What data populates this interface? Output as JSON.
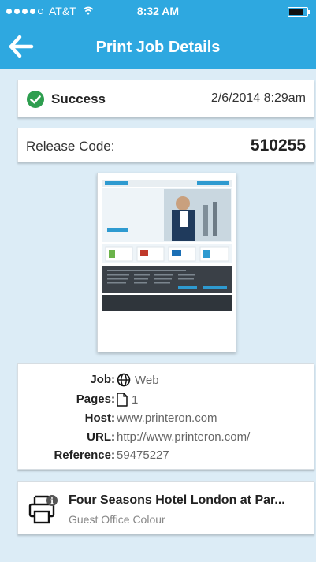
{
  "statusbar": {
    "carrier": "AT&T",
    "time": "8:32 AM"
  },
  "header": {
    "title": "Print Job Details"
  },
  "status": {
    "label": "Success",
    "datetime": "2/6/2014 8:29am",
    "color": "#2e9e4f"
  },
  "release": {
    "label": "Release Code:",
    "code": "510255"
  },
  "preview": {
    "heading": "PrinterOn Enterprise 3.2 released."
  },
  "details": {
    "job_key": "Job:",
    "job_val": "Web",
    "pages_key": "Pages:",
    "pages_val": "1",
    "host_key": "Host:",
    "host_val": "www.printeron.com",
    "url_key": "URL:",
    "url_val": "http://www.printeron.com/",
    "ref_key": "Reference:",
    "ref_val": "59475227"
  },
  "printer": {
    "name": "Four Seasons Hotel London at Par...",
    "type": "Guest Office Colour"
  },
  "colors": {
    "accent": "#2ea8e0",
    "background": "#dcecf6"
  }
}
